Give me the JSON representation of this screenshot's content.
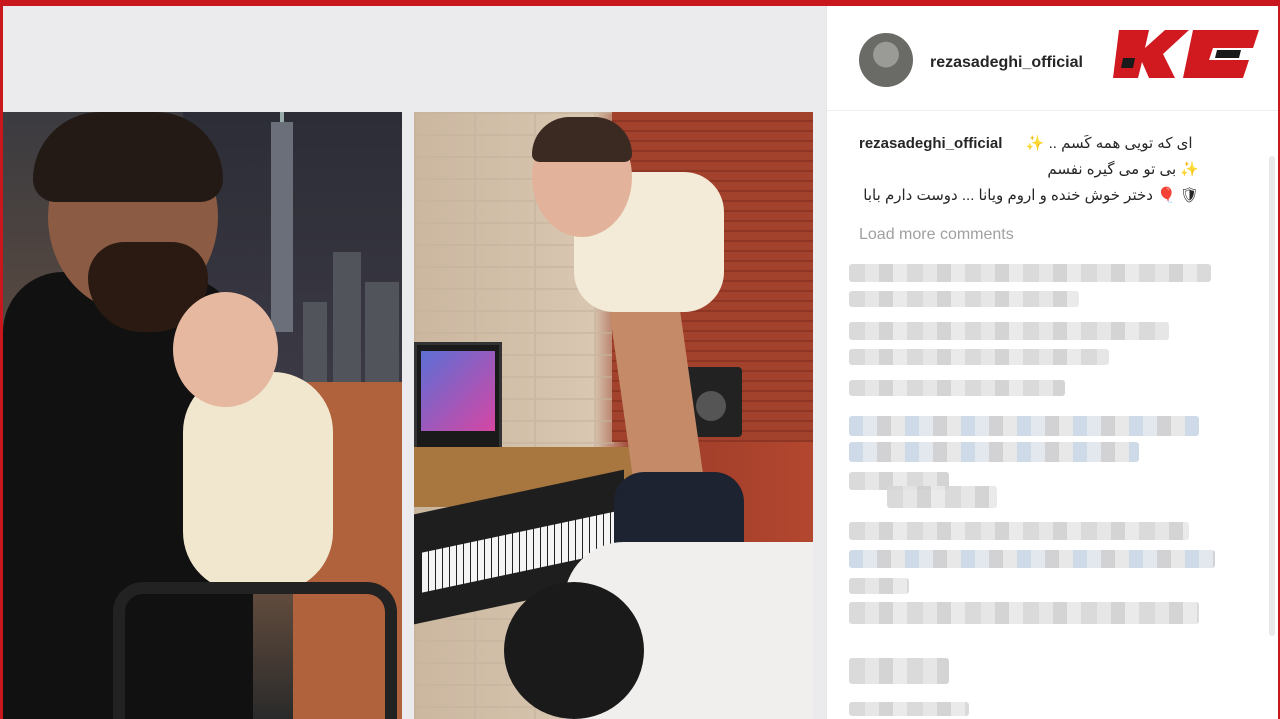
{
  "post": {
    "username": "rezasadeghi_official",
    "caption_user": "rezasadeghi_official",
    "caption_lines": [
      "ای که تویی همه کَسم .. ✨",
      "✨ بی تو می گیره نفسم",
      "🛡 🎈 دختر خوش خنده و اروم ویانا ... دوست دارم بابا"
    ],
    "load_more": "Load more comments"
  },
  "colors": {
    "brand_red": "#c8181e",
    "text_primary": "#262626",
    "text_muted": "#a0a0a0"
  },
  "icons": {
    "avatar": "profile-picture",
    "brand": "rokna-logo"
  }
}
